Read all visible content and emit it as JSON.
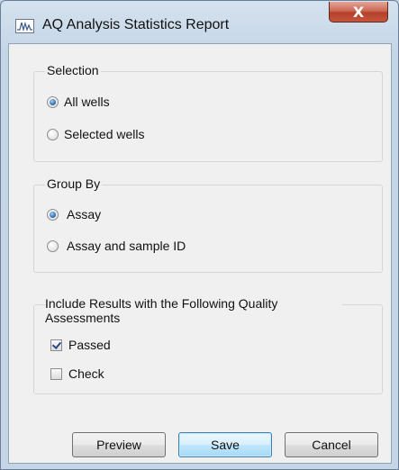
{
  "window": {
    "title": "AQ Analysis Statistics Report",
    "close_label": "X",
    "icon": "waveform-icon"
  },
  "selection": {
    "title": "Selection",
    "options": [
      {
        "label": "All wells",
        "checked": true
      },
      {
        "label": "Selected wells",
        "checked": false
      }
    ]
  },
  "group_by": {
    "title": "Group By",
    "options": [
      {
        "label": "Assay",
        "checked": true
      },
      {
        "label": "Assay and sample ID",
        "checked": false
      }
    ]
  },
  "quality": {
    "title": "Include Results with the Following Quality Assessments",
    "options": [
      {
        "label": "Passed",
        "checked": true
      },
      {
        "label": "Check",
        "checked": false
      }
    ]
  },
  "buttons": {
    "preview": "Preview",
    "save": "Save",
    "cancel": "Cancel"
  },
  "colors": {
    "close_button": "#c5553d",
    "radio_selected": "#2f6fb3",
    "default_button_border": "#3c7fb1"
  }
}
